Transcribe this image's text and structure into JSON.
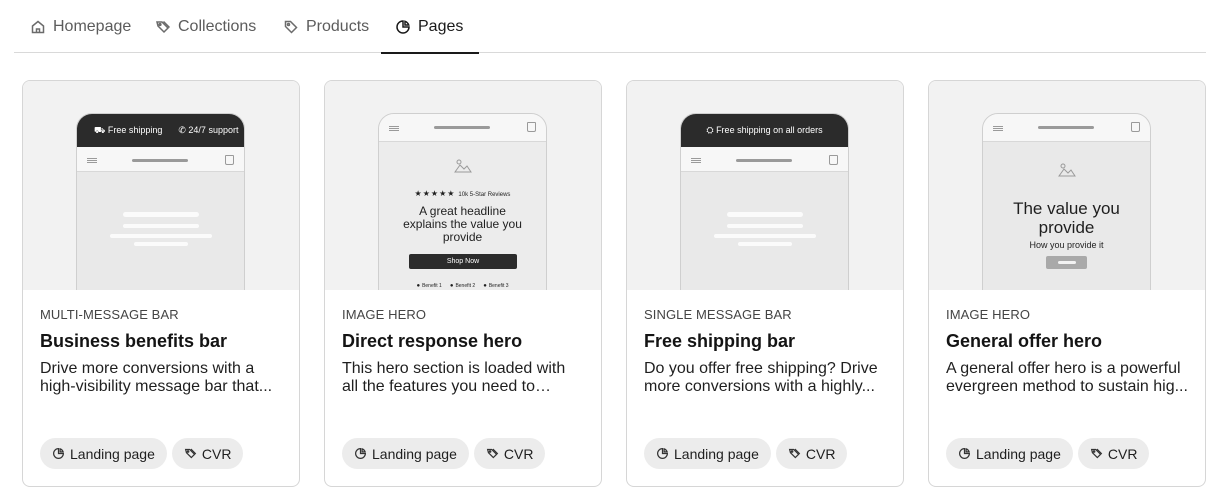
{
  "tabs": [
    {
      "label": "Homepage",
      "icon": "home-icon"
    },
    {
      "label": "Collections",
      "icon": "tags-icon"
    },
    {
      "label": "Products",
      "icon": "tag-icon"
    },
    {
      "label": "Pages",
      "icon": "page-icon",
      "active": true
    }
  ],
  "cards": [
    {
      "category": "MULTI-MESSAGE BAR",
      "title": "Business benefits bar",
      "description": "Drive more conversions with a high-visibility message bar that...",
      "preview": {
        "announce_1": "Free shipping",
        "announce_2": "24/7 support"
      },
      "chips": [
        "Landing page",
        "CVR"
      ]
    },
    {
      "category": "IMAGE HERO",
      "title": "Direct response hero",
      "description": "This hero section is loaded with all the features you need to drive...",
      "preview": {
        "stars": "★★★★★",
        "reviews": "10k 5-Star Reviews",
        "headline": "A great headline explains the value you provide",
        "button": "Shop Now",
        "benefits": [
          "Benefit 1",
          "Benefit 2",
          "Benefit 3"
        ]
      },
      "chips": [
        "Landing page",
        "CVR"
      ]
    },
    {
      "category": "SINGLE MESSAGE BAR",
      "title": "Free shipping bar",
      "description": "Do you offer free shipping? Drive more conversions with a highly...",
      "preview": {
        "announce": "Free shipping on all orders"
      },
      "chips": [
        "Landing page",
        "CVR"
      ]
    },
    {
      "category": "IMAGE HERO",
      "title": "General offer hero",
      "description": "A general offer hero is a powerful evergreen method to sustain hig...",
      "preview": {
        "headline": "The value you provide",
        "subline": "How you provide it"
      },
      "chips": [
        "Landing page",
        "CVR"
      ]
    }
  ]
}
